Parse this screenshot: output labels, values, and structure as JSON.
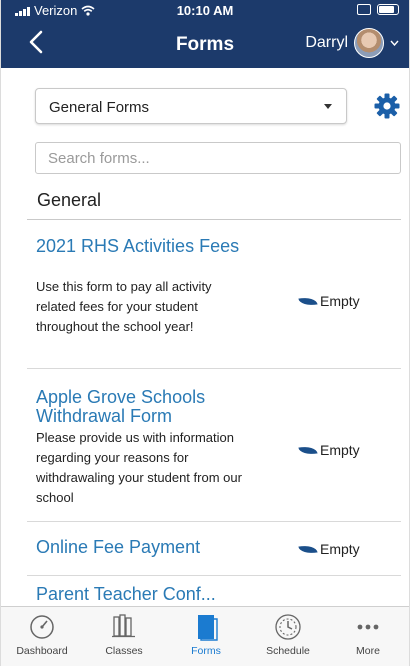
{
  "status_bar": {
    "carrier": "Verizon",
    "time": "10:10 AM"
  },
  "nav": {
    "back_icon": "chevron-left-icon",
    "title": "Forms",
    "user_name": "Darryl"
  },
  "filter": {
    "selected": "General Forms",
    "settings_icon": "gear-icon"
  },
  "search": {
    "placeholder": "Search forms...",
    "value": ""
  },
  "section": {
    "title": "General"
  },
  "forms": [
    {
      "name": "2021 RHS Activities Fees",
      "description": "Use this form to pay all activity related fees for your student throughout the school year!",
      "status": "Empty"
    },
    {
      "name": "Apple Grove Schools Withdrawal Form",
      "description": "Please provide us with information regarding your reasons for withdrawaling your student from our school",
      "status": "Empty"
    },
    {
      "name": "Online Fee Payment",
      "description": "",
      "status": "Empty"
    },
    {
      "name": "Parent Teacher Conf...",
      "description": "",
      "status": ""
    }
  ],
  "tabs": [
    {
      "label": "Dashboard",
      "icon": "gauge-icon",
      "active": false
    },
    {
      "label": "Classes",
      "icon": "books-icon",
      "active": false
    },
    {
      "label": "Forms",
      "icon": "document-icon",
      "active": true
    },
    {
      "label": "Schedule",
      "icon": "clock-icon",
      "active": false
    },
    {
      "label": "More",
      "icon": "more-dots-icon",
      "active": false
    }
  ],
  "colors": {
    "header_bg": "#1c3a6b",
    "link": "#2a7ab5",
    "active_tab": "#1b7bd0",
    "accent_icon": "#1b5fa8"
  }
}
